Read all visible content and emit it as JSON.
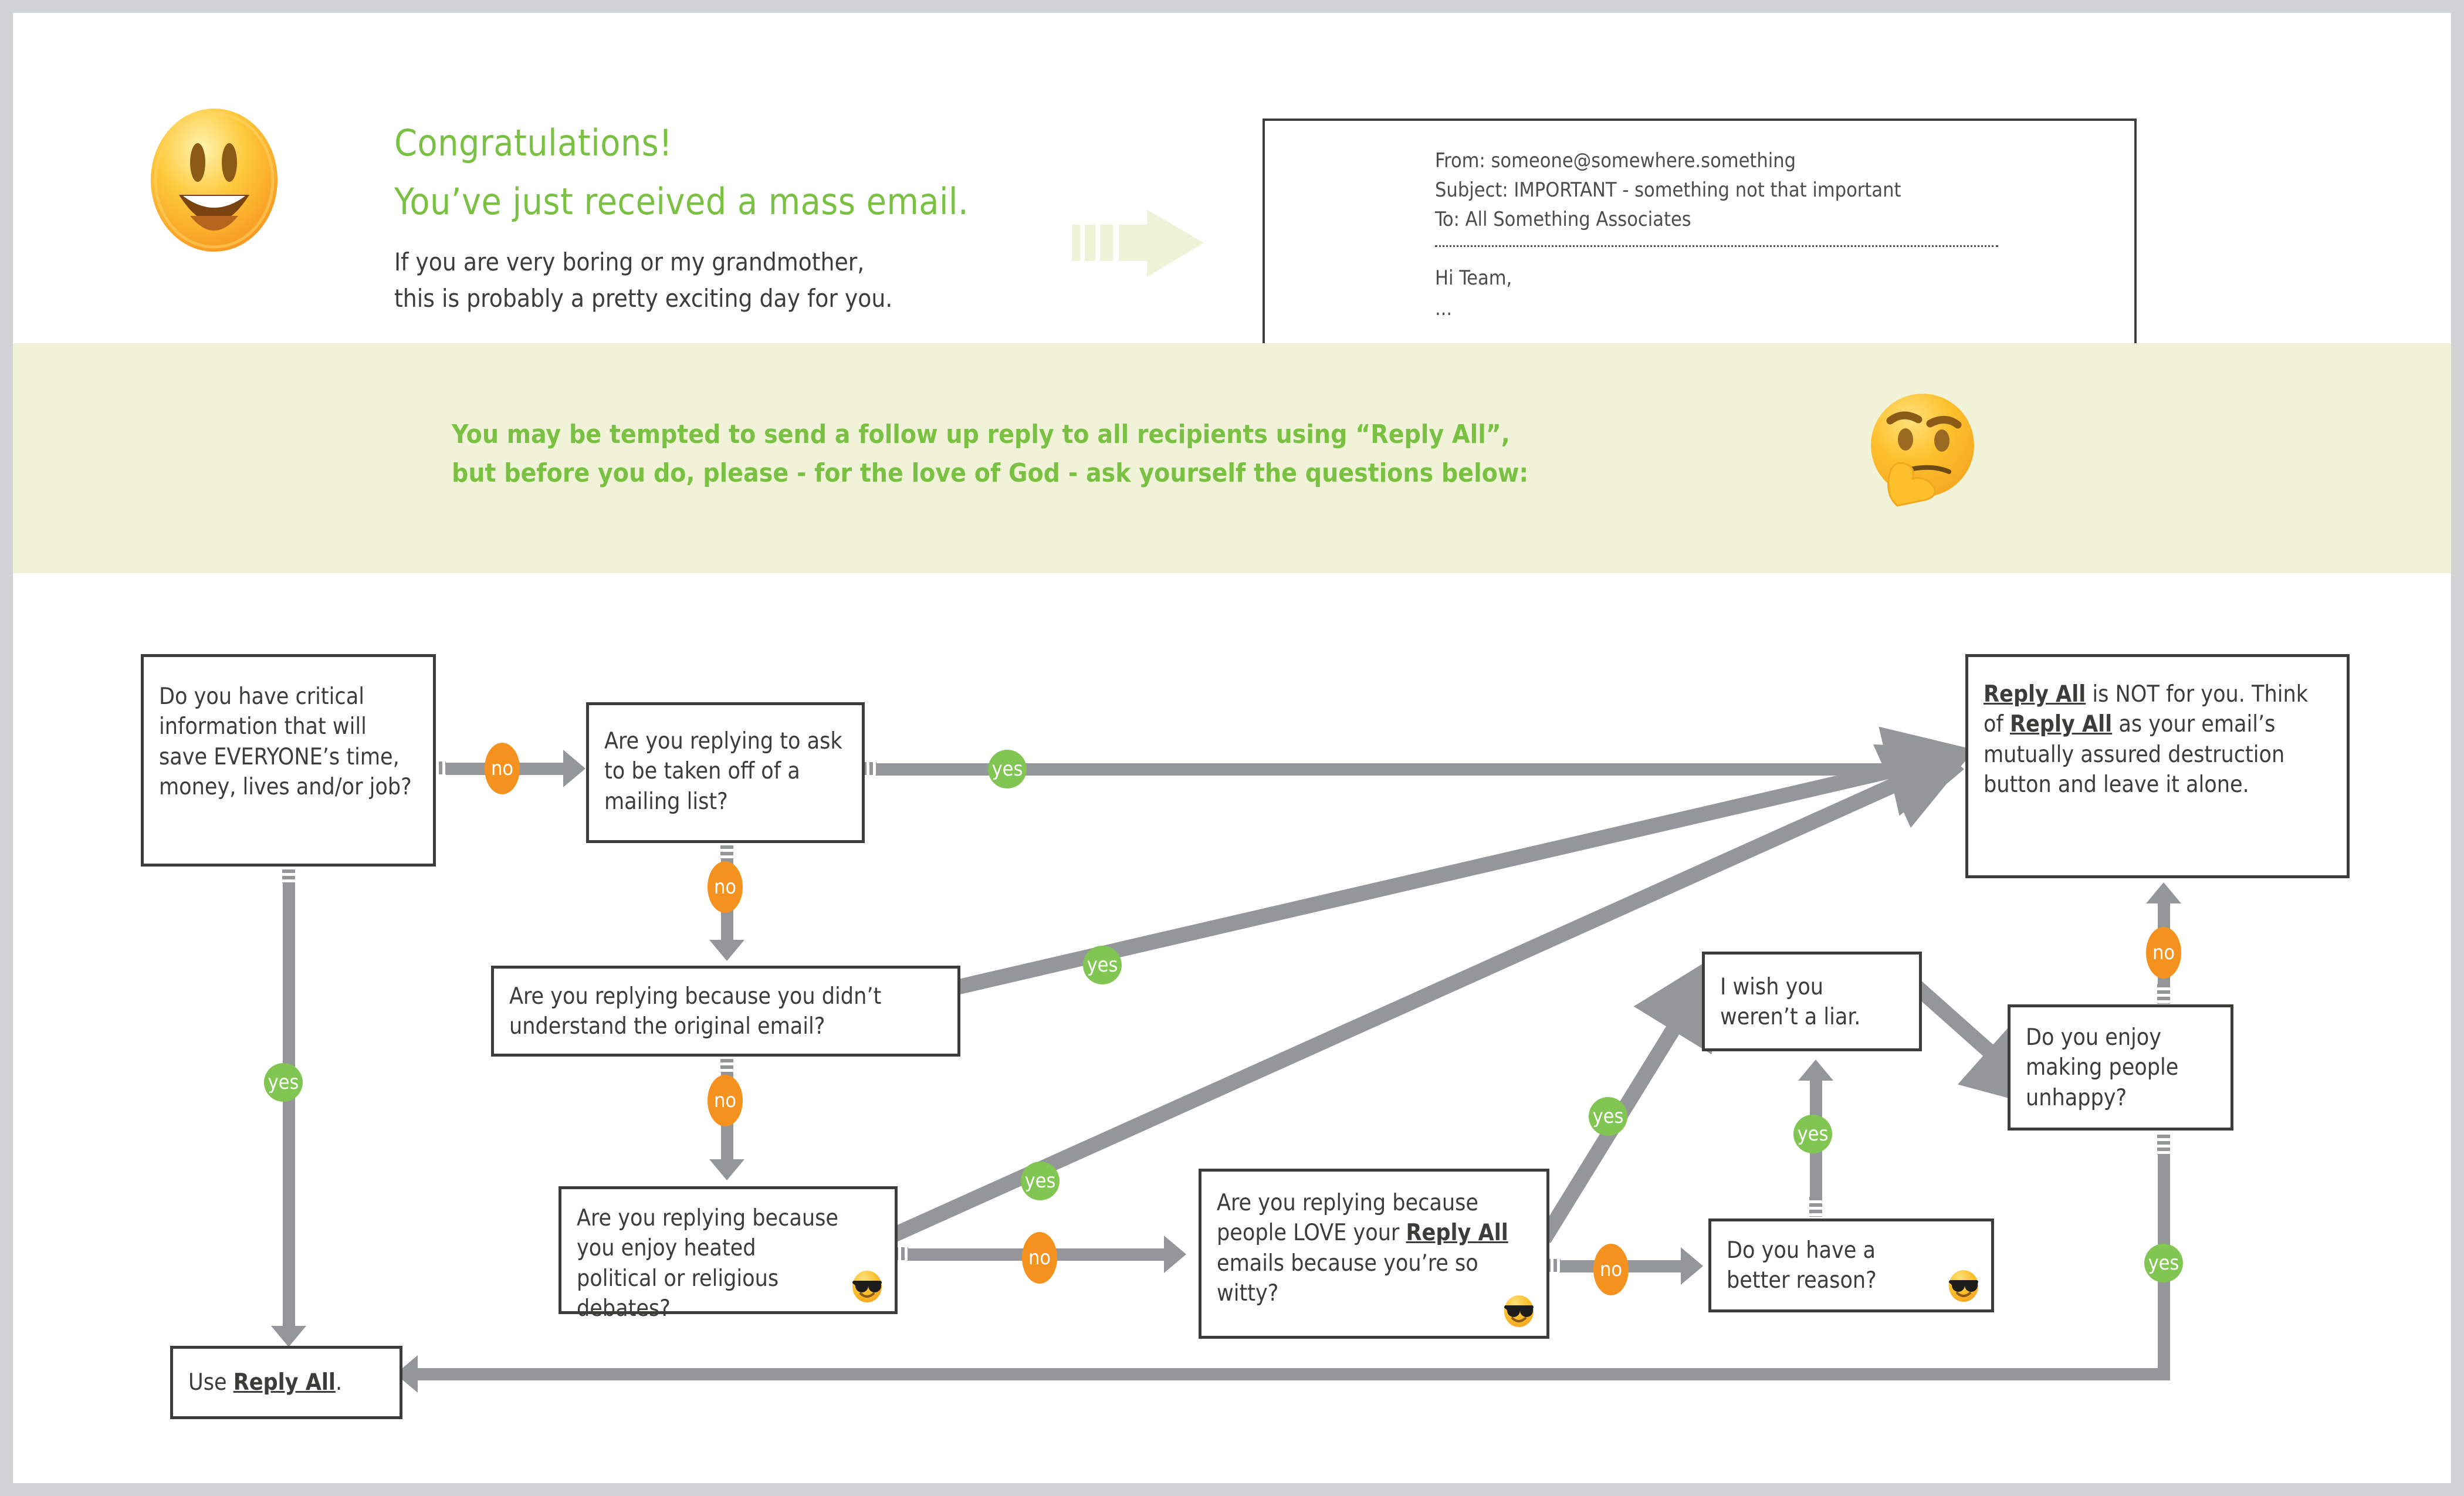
{
  "page": {
    "background": "#d1d3d4",
    "sheet_background": "#ffffff"
  },
  "header": {
    "emoji": "grinning-face-emoji",
    "title_line1": "Congratulations!",
    "title_line2": "You’ve just received a mass email.",
    "sub_line1": "If you are very boring or my grandmother,",
    "sub_line2": "this is probably a pretty exciting day for you.",
    "arrow_icon": "right-arrow-icon",
    "title_color": "#7ac143",
    "body_color": "#3c3c3b"
  },
  "email_card": {
    "from": "From: someone@somewhere.something",
    "subject": "Subject: IMPORTANT - something not that important",
    "to": "To: All Something Associates",
    "divider": "dotted-divider",
    "greeting": "Hi Team,",
    "ellipsis": "..."
  },
  "banner": {
    "background": "#f0f3d8",
    "line1": "You may be tempted to send a follow up reply to all recipients using “Reply All”,",
    "line2": "but before you do, please - for the love of God - ask yourself the questions below:",
    "text_color": "#7ac143",
    "emoji": "thinking-face-emoji"
  },
  "flowchart": {
    "colors": {
      "yes": "#81c552",
      "no": "#f5911e",
      "connector": "#949699",
      "node_border": "#3c3c3b"
    },
    "nodes": [
      {
        "id": "q_critical",
        "text_html": "Do you have critical information that will save EVERYONE’s time, money, lives and/or job?"
      },
      {
        "id": "q_mailing",
        "text_html": "Are you replying to ask to be taken off of a mailing list?"
      },
      {
        "id": "q_understand",
        "text_html": "Are you replying because you didn’t understand the original email?"
      },
      {
        "id": "q_debates",
        "text_html": "Are you replying because you enjoy heated political or religious debates?",
        "emoji": "sunglasses-face-emoji"
      },
      {
        "id": "q_witty",
        "text_html": "Are you replying because people LOVE your <b>Reply All</b> emails because you’re so witty?",
        "emoji": "sunglasses-face-emoji"
      },
      {
        "id": "q_better",
        "text_html": "Do you have a better reason?",
        "emoji": "sunglasses-face-emoji"
      },
      {
        "id": "s_liar",
        "text_html": "I wish you weren’t a liar."
      },
      {
        "id": "q_unhappy",
        "text_html": "Do you enjoy making people unhappy?"
      },
      {
        "id": "r_notforyou",
        "text_html": "<b>Reply All</b> is NOT for you. Think of <b>Reply All</b> as your email’s mutually assured destruction button and leave it alone."
      },
      {
        "id": "r_usereplyall",
        "text_html": "Use <b>Reply All</b>."
      }
    ],
    "edges": [
      {
        "from": "q_critical",
        "to": "q_mailing",
        "label": "no"
      },
      {
        "from": "q_critical",
        "to": "r_usereplyall",
        "label": "yes"
      },
      {
        "from": "q_mailing",
        "to": "r_notforyou",
        "label": "yes"
      },
      {
        "from": "q_mailing",
        "to": "q_understand",
        "label": "no"
      },
      {
        "from": "q_understand",
        "to": "r_notforyou",
        "label": "yes"
      },
      {
        "from": "q_understand",
        "to": "q_debates",
        "label": "no"
      },
      {
        "from": "q_debates",
        "to": "r_notforyou",
        "label": "yes"
      },
      {
        "from": "q_debates",
        "to": "q_witty",
        "label": "no"
      },
      {
        "from": "q_witty",
        "to": "s_liar",
        "label": "yes"
      },
      {
        "from": "q_witty",
        "to": "q_better",
        "label": "no"
      },
      {
        "from": "q_better",
        "to": "s_liar",
        "label": "yes"
      },
      {
        "from": "s_liar",
        "to": "q_unhappy",
        "label": ""
      },
      {
        "from": "q_unhappy",
        "to": "r_notforyou",
        "label": "no"
      },
      {
        "from": "q_unhappy",
        "to": "r_usereplyall",
        "label": "yes"
      }
    ],
    "labels": {
      "no": "no",
      "yes": "yes"
    }
  }
}
